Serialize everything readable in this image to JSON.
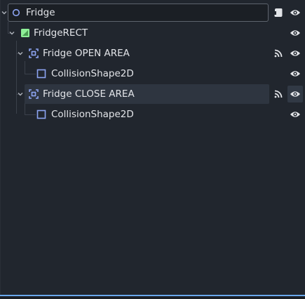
{
  "colors": {
    "background": "#21262e",
    "text": "#e2e4e8",
    "node2d_blue": "#8da5f3",
    "control_green": "#8eef97",
    "accent": "#6aa8ec"
  },
  "tree": {
    "root": {
      "name": "Fridge",
      "icon": "node2d-circle-icon",
      "script_icon": "script-icon"
    },
    "nodes": [
      {
        "name": "FridgeRECT",
        "icon": "color-rect-icon"
      },
      {
        "name": "Fridge OPEN AREA",
        "icon": "area2d-icon",
        "signal_icon": "signal-icon"
      },
      {
        "name": "CollisionShape2D",
        "icon": "collision-shape-icon"
      },
      {
        "name": "Fridge CLOSE AREA",
        "icon": "area2d-icon",
        "signal_icon": "signal-icon"
      },
      {
        "name": "CollisionShape2D",
        "icon": "collision-shape-icon"
      }
    ],
    "visibility_icon": "eye-icon"
  }
}
